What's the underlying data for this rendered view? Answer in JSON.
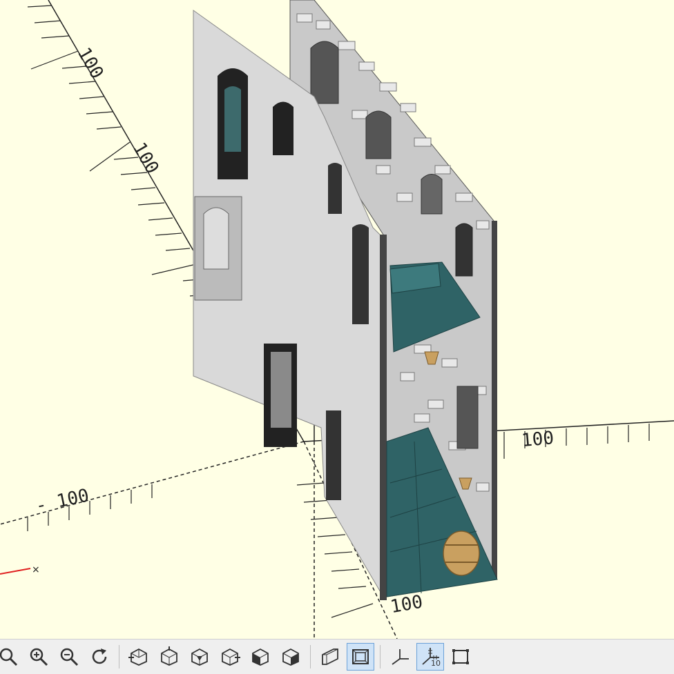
{
  "viewport": {
    "background": "#ffffe5",
    "axis_labels": [
      "100",
      "100",
      "- 100",
      "100",
      "100"
    ],
    "origin_marker": "×"
  },
  "model": {
    "wall_color": "#d8d8d8",
    "stone_color": "#bdbdbd",
    "floor_color": "#2f6366",
    "barrel_color": "#c9a060"
  },
  "toolbar": {
    "buttons": [
      {
        "name": "zoom-all-button",
        "icon": "zoom-all-icon"
      },
      {
        "name": "zoom-in-button",
        "icon": "zoom-in-icon"
      },
      {
        "name": "zoom-out-button",
        "icon": "zoom-out-icon"
      },
      {
        "name": "reset-view-button",
        "icon": "reset-view-icon"
      },
      {
        "name": "view-right-button",
        "icon": "view-right-icon"
      },
      {
        "name": "view-top-button",
        "icon": "view-top-icon"
      },
      {
        "name": "view-bottom-button",
        "icon": "view-bottom-icon"
      },
      {
        "name": "view-left-button",
        "icon": "view-left-icon"
      },
      {
        "name": "view-front-button",
        "icon": "view-front-icon"
      },
      {
        "name": "view-back-button",
        "icon": "view-back-icon"
      },
      {
        "name": "perspective-button",
        "icon": "perspective-icon"
      },
      {
        "name": "orthogonal-button",
        "icon": "orthogonal-icon"
      },
      {
        "name": "show-axes-button",
        "icon": "axes-icon"
      },
      {
        "name": "show-scale-markers-button",
        "icon": "scale-markers-icon"
      },
      {
        "name": "show-edges-button",
        "icon": "edges-icon"
      }
    ],
    "scale_marker_number": "10"
  }
}
